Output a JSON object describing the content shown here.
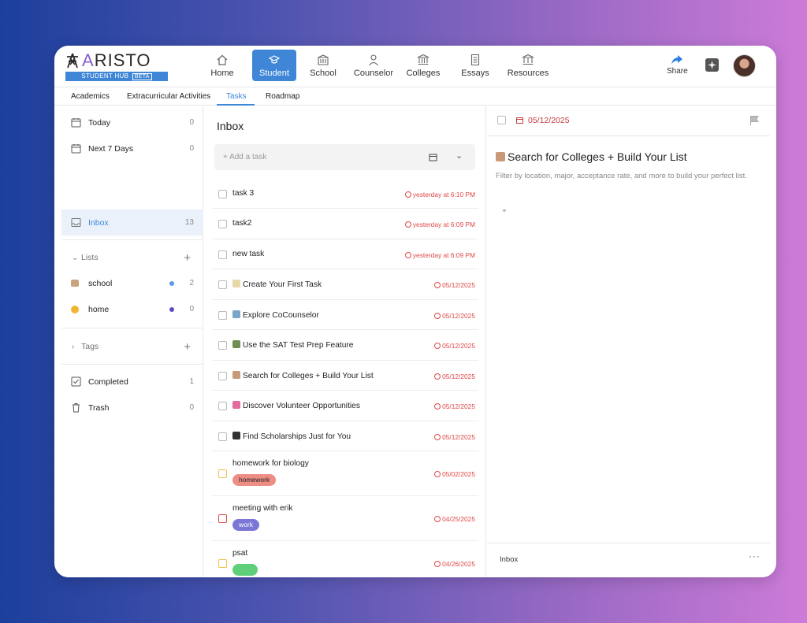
{
  "app": {
    "logo_text_a": "A",
    "logo_text_rest": "RISTO",
    "badge": "STUDENT HUB",
    "badge_beta": "BETA"
  },
  "nav": {
    "items": [
      {
        "label": "Home",
        "icon": "home-icon"
      },
      {
        "label": "Student",
        "icon": "student-icon"
      },
      {
        "label": "School",
        "icon": "school-icon"
      },
      {
        "label": "Counselor",
        "icon": "counselor-icon"
      },
      {
        "label": "Colleges",
        "icon": "colleges-icon"
      },
      {
        "label": "Essays",
        "icon": "essays-icon"
      },
      {
        "label": "Resources",
        "icon": "resources-icon"
      }
    ],
    "active": "Student",
    "share": "Share"
  },
  "subtabs": [
    "Academics",
    "Extracurricular Activities",
    "Tasks",
    "Roadmap"
  ],
  "sidebar": {
    "items": [
      {
        "label": "Today",
        "count": "0"
      },
      {
        "label": "Next 7 Days",
        "count": "0"
      },
      {
        "label": "Inbox",
        "count": "13"
      }
    ],
    "lists_header": "Lists",
    "lists": [
      {
        "label": "school",
        "count": "2",
        "dot": "#5a9be6"
      },
      {
        "label": "home",
        "count": "0",
        "dot": "#5b4bc4"
      }
    ],
    "tags_header": "Tags",
    "bottom": [
      {
        "label": "Completed",
        "count": "1"
      },
      {
        "label": "Trash",
        "count": "0"
      }
    ]
  },
  "inbox": {
    "title": "Inbox",
    "add_placeholder": "Add a task",
    "tasks": [
      {
        "title": "task 3",
        "due": "yesterday at 6:10 PM"
      },
      {
        "title": "task2",
        "due": "yesterday at 6:09 PM"
      },
      {
        "title": "new task",
        "due": "yesterday at 6:09 PM"
      },
      {
        "title": "Create Your First Task",
        "due": "05/12/2025"
      },
      {
        "title": "Explore CoCounselor",
        "due": "05/12/2025"
      },
      {
        "title": "Use the SAT Test Prep Feature",
        "due": "05/12/2025"
      },
      {
        "title": "Search for Colleges + Build Your List",
        "due": "05/12/2025"
      },
      {
        "title": "Discover Volunteer Opportunities",
        "due": "05/12/2025"
      },
      {
        "title": "Find Scholarships Just for You",
        "due": "05/12/2025"
      },
      {
        "title": "homework for biology",
        "due": "05/02/2025",
        "tag": "homework"
      },
      {
        "title": "meeting with erik",
        "due": "04/25/2025",
        "tag": "work"
      },
      {
        "title": "psat",
        "due": "04/26/2025",
        "tag": ""
      }
    ]
  },
  "detail": {
    "date": "05/12/2025",
    "title": "Search for Colleges + Build Your List",
    "description": "Filter by location, major, acceptance rate, and more to build your perfect list.",
    "add": "+",
    "footer_list": "Inbox",
    "footer_more": "···"
  },
  "colors": {
    "accent": "#3f86d6",
    "overdue": "#e04848",
    "tag_homework": "#ee8d86",
    "tag_work": "#7c77d6",
    "tag_psat": "#5fcf7a"
  }
}
